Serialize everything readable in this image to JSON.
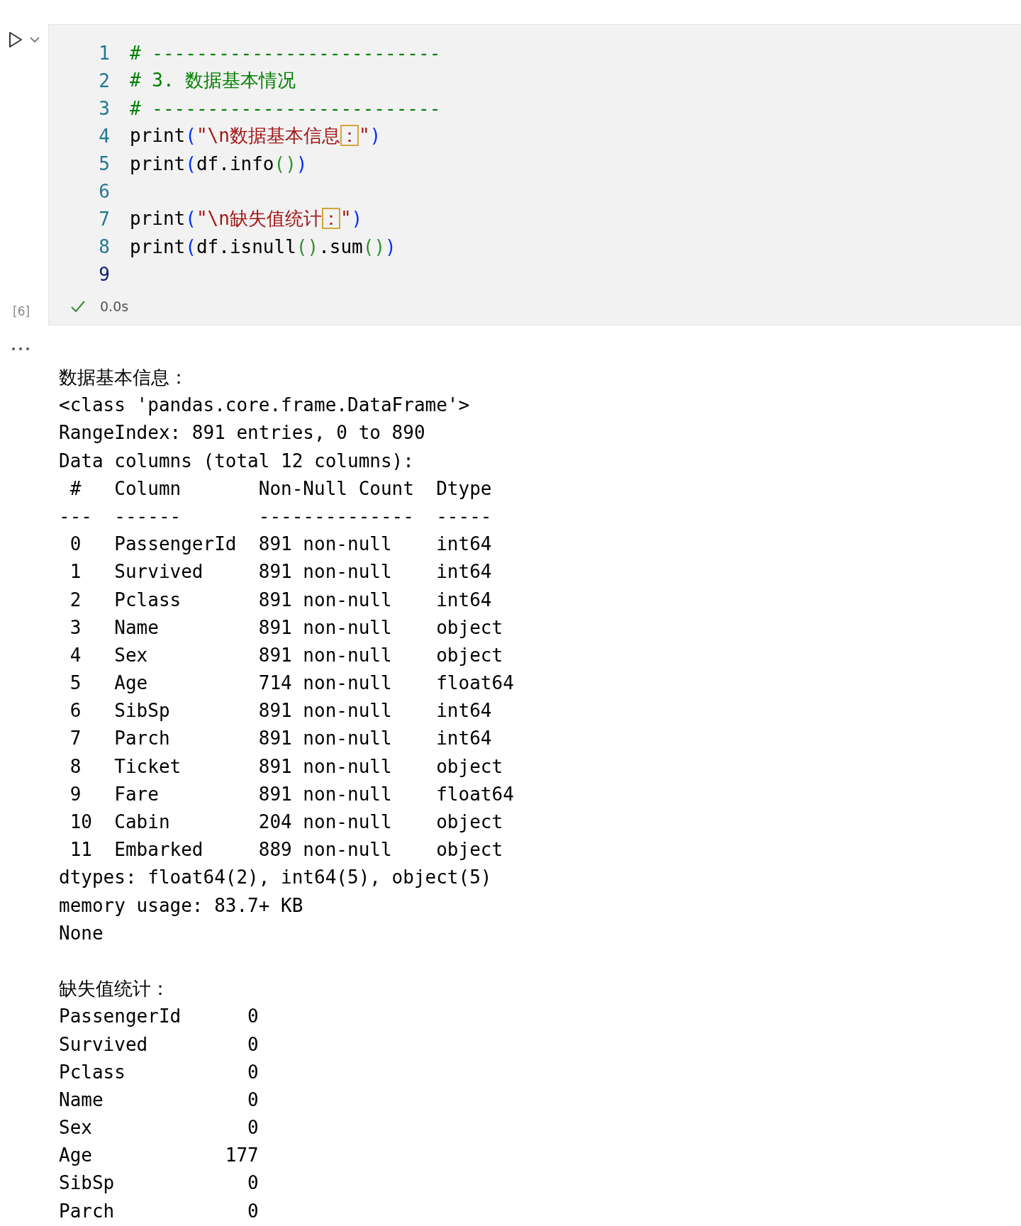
{
  "cell": {
    "exec_count": "[6]",
    "succeeded": true,
    "duration": "0.0s",
    "code_lines": [
      {
        "number": "1",
        "current": false,
        "tokens": [
          {
            "kind": "comment",
            "text": "# --------------------------"
          }
        ]
      },
      {
        "number": "2",
        "current": false,
        "tokens": [
          {
            "kind": "comment",
            "text": "# 3. 数据基本情况"
          }
        ]
      },
      {
        "number": "3",
        "current": false,
        "tokens": [
          {
            "kind": "comment",
            "text": "# --------------------------"
          }
        ]
      },
      {
        "number": "4",
        "current": false,
        "tokens": [
          {
            "kind": "func",
            "text": "print"
          },
          {
            "kind": "bracket1",
            "text": "("
          },
          {
            "kind": "string",
            "text": "\"\\n数据基本信息"
          },
          {
            "kind": "ambiguous",
            "text": "："
          },
          {
            "kind": "string",
            "text": "\""
          },
          {
            "kind": "bracket1",
            "text": ")"
          }
        ]
      },
      {
        "number": "5",
        "current": false,
        "tokens": [
          {
            "kind": "func",
            "text": "print"
          },
          {
            "kind": "bracket1",
            "text": "("
          },
          {
            "kind": "plain",
            "text": "df.info"
          },
          {
            "kind": "bracket2",
            "text": "()"
          },
          {
            "kind": "bracket1",
            "text": ")"
          }
        ]
      },
      {
        "number": "6",
        "current": false
      },
      {
        "number": "7",
        "current": false,
        "tokens": [
          {
            "kind": "func",
            "text": "print"
          },
          {
            "kind": "bracket1",
            "text": "("
          },
          {
            "kind": "string",
            "text": "\"\\n缺失值统计"
          },
          {
            "kind": "ambiguous",
            "text": "："
          },
          {
            "kind": "string",
            "text": "\""
          },
          {
            "kind": "bracket1",
            "text": ")"
          }
        ]
      },
      {
        "number": "8",
        "current": false,
        "tokens": [
          {
            "kind": "func",
            "text": "print"
          },
          {
            "kind": "bracket1",
            "text": "("
          },
          {
            "kind": "plain",
            "text": "df.isnull"
          },
          {
            "kind": "bracket2",
            "text": "()"
          },
          {
            "kind": "plain",
            "text": ".sum"
          },
          {
            "kind": "bracket2",
            "text": "()"
          },
          {
            "kind": "bracket1",
            "text": ")"
          }
        ]
      },
      {
        "number": "9",
        "current": true
      }
    ]
  },
  "output": {
    "blocks": [
      {
        "lines": [
          "数据基本信息：",
          "<class 'pandas.core.frame.DataFrame'>",
          "RangeIndex: 891 entries, 0 to 890",
          "Data columns (total 12 columns):",
          " #   Column       Non-Null Count  Dtype",
          "---  ------       --------------  -----",
          " 0   PassengerId  891 non-null    int64",
          " 1   Survived     891 non-null    int64",
          " 2   Pclass       891 non-null    int64",
          " 3   Name         891 non-null    object",
          " 4   Sex          891 non-null    object",
          " 5   Age          714 non-null    float64",
          " 6   SibSp        891 non-null    int64",
          " 7   Parch        891 non-null    int64",
          " 8   Ticket       891 non-null    object",
          " 9   Fare         891 non-null    float64",
          " 10  Cabin        204 non-null    object",
          " 11  Embarked     889 non-null    object",
          "dtypes: float64(2), int64(5), object(5)",
          "memory usage: 83.7+ KB",
          "None"
        ]
      },
      {
        "lines": [
          "缺失值统计：",
          "PassengerId      0",
          "Survived         0",
          "Pclass           0",
          "Name             0",
          "Sex              0",
          "Age            177",
          "SibSp            0",
          "Parch            0"
        ]
      }
    ]
  }
}
